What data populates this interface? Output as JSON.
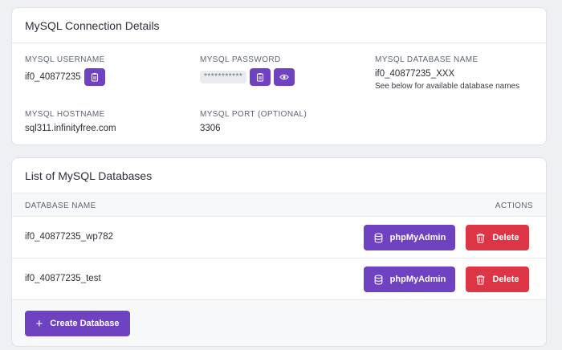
{
  "connection": {
    "title": "MySQL Connection Details",
    "username_label": "MySQL Username",
    "username": "if0_40877235",
    "password_label": "MySQL Password",
    "password_mask": "***********",
    "dbname_label": "MySQL Database Name",
    "dbname": "if0_40877235_XXX",
    "dbname_note": "See below for available database names",
    "hostname_label": "MySQL Hostname",
    "hostname": "sql311.infinityfree.com",
    "port_label": "MySQL Port (Optional)",
    "port": "3306"
  },
  "databases": {
    "title": "List of MySQL Databases",
    "col_name": "DATABASE NAME",
    "col_actions": "ACTIONS",
    "rows": [
      {
        "name": "if0_40877235_wp782",
        "pma_label": "phpMyAdmin",
        "delete_label": "Delete"
      },
      {
        "name": "if0_40877235_test",
        "pma_label": "phpMyAdmin",
        "delete_label": "Delete"
      }
    ],
    "create_label": "Create Database"
  },
  "colors": {
    "purple": "#6f42c1",
    "red": "#dc3545"
  }
}
